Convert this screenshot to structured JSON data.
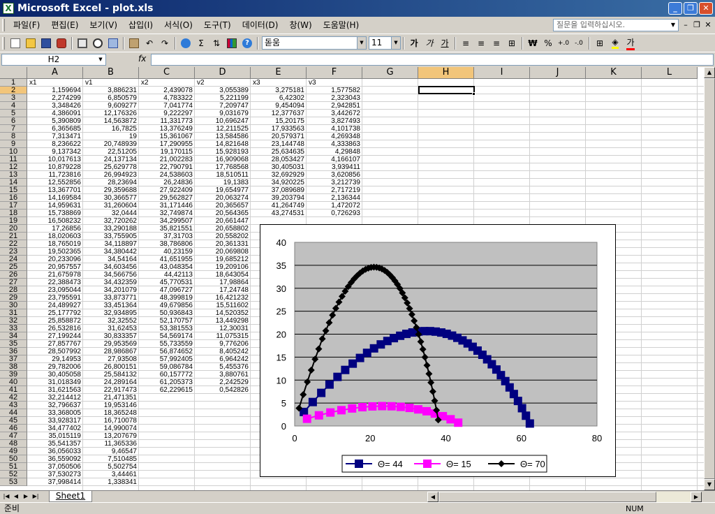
{
  "window": {
    "title": "Microsoft Excel - plot.xls",
    "app_icon": "X"
  },
  "menu": {
    "items": [
      "파일(F)",
      "편집(E)",
      "보기(V)",
      "삽입(I)",
      "서식(O)",
      "도구(T)",
      "데이터(D)",
      "창(W)",
      "도움말(H)"
    ],
    "help_placeholder": "질문을 입력하십시오."
  },
  "toolbar": {
    "font": "돋움",
    "size": "11",
    "bold": "가",
    "italic": "가",
    "underline": "가",
    "currency": "₩",
    "percent": "%",
    "autosum": "Σ",
    "font_color": "가"
  },
  "formula": {
    "name_box": "H2",
    "fx": "fx",
    "content": ""
  },
  "columns": [
    "A",
    "B",
    "C",
    "D",
    "E",
    "F",
    "G",
    "H",
    "I",
    "J",
    "K",
    "L"
  ],
  "selected_column": "H",
  "header_row": [
    "x1",
    "v1",
    "x2",
    "v2",
    "x3",
    "v3"
  ],
  "sheet": {
    "A": [
      "1,159694",
      "2,274299",
      "3,348426",
      "4,386091",
      "5,390809",
      "6,365685",
      "7,313471",
      "8,236622",
      "9,137342",
      "10,017613",
      "10,879228",
      "11,723816",
      "12,552856",
      "13,367701",
      "14,169584",
      "14,959631",
      "15,738869",
      "16,508232",
      "17,26856",
      "18,020603",
      "18,765019",
      "19,502365",
      "20,233096",
      "20,957557",
      "21,675978",
      "22,388473",
      "23,095044",
      "23,795591",
      "24,489927",
      "25,177792",
      "25,858872",
      "26,532816",
      "27,199244",
      "27,857767",
      "28,507992",
      "29,14953",
      "29,782006",
      "30,405058",
      "31,018349",
      "31,621563",
      "32,214412",
      "32,796637",
      "33,368005",
      "33,928317",
      "34,477402",
      "35,015119",
      "35,541357",
      "36,056033",
      "36,559092",
      "37,050506",
      "37,530273",
      "37,998414"
    ],
    "B": [
      "3,886231",
      "6,850579",
      "9,609277",
      "12,176326",
      "14,563872",
      "16,7825",
      "19",
      "20,748939",
      "22,51205",
      "24,137134",
      "25,629778",
      "26,994923",
      "28,23694",
      "29,359688",
      "30,366577",
      "31,260604",
      "32,0444",
      "32,720262",
      "33,290188",
      "33,755905",
      "34,118897",
      "34,380442",
      "34,54164",
      "34,603456",
      "34,566756",
      "34,432359",
      "34,201079",
      "33,873771",
      "33,451364",
      "32,934895",
      "32,32552",
      "31,62453",
      "30,833357",
      "29,953569",
      "28,986867",
      "27,93508",
      "26,800151",
      "25,584132",
      "24,289164",
      "22,917473",
      "21,471351",
      "19,953146",
      "18,365248",
      "16,710078",
      "14,990074",
      "13,207679",
      "11,365336",
      "9,46547",
      "7,510485",
      "5,502754",
      "3,44461",
      "1,338341"
    ],
    "C": [
      "2,439078",
      "4,783322",
      "7,041774",
      "9,222297",
      "11,331773",
      "13,376249",
      "15,361067",
      "17,290955",
      "19,170115",
      "21,002283",
      "22,790791",
      "24,538603",
      "26,24836",
      "27,922409",
      "29,562827",
      "31,171446",
      "32,749874",
      "34,299507",
      "35,821551",
      "37,31703",
      "38,786806",
      "40,23159",
      "41,651955",
      "43,048354",
      "44,42113",
      "45,770531",
      "47,096727",
      "48,399819",
      "49,679856",
      "50,936843",
      "52,170757",
      "53,381553",
      "54,569174",
      "55,733559",
      "56,874652",
      "57,992405",
      "59,086784",
      "60,157772",
      "61,205373",
      "62,229615"
    ],
    "D": [
      "3,055389",
      "5,221199",
      "7,209747",
      "9,031679",
      "10,696247",
      "12,211525",
      "13,584586",
      "14,821648",
      "15,928193",
      "16,909068",
      "17,768568",
      "18,510511",
      "19,1383",
      "19,654977",
      "20,063274",
      "20,365657",
      "20,564365",
      "20,661447",
      "20,658802",
      "20,558202",
      "20,361331",
      "20,069808",
      "19,685212",
      "19,209106",
      "18,643054",
      "17,98864",
      "17,24748",
      "16,421232",
      "15,511602",
      "14,520352",
      "13,449298",
      "12,30031",
      "11,075315",
      "9,776206",
      "8,405242",
      "6,964242",
      "5,455376",
      "3,880761",
      "2,242529",
      "0,542826"
    ],
    "E": [
      "3,275181",
      "6,42302",
      "9,454094",
      "12,377637",
      "15,20175",
      "17,933563",
      "20,579371",
      "23,144748",
      "25,634635",
      "28,053427",
      "30,405031",
      "32,692929",
      "34,920225",
      "37,089689",
      "39,203794",
      "41,264749",
      "43,274531"
    ],
    "F": [
      "1,577582",
      "2,323043",
      "2,942851",
      "3,442672",
      "3,827493",
      "4,101738",
      "4,269348",
      "4,333863",
      "4,29848",
      "4,166107",
      "3,939411",
      "3,620856",
      "3,212739",
      "2,717219",
      "2,136344",
      "1,472072",
      "0,726293"
    ]
  },
  "row_numbers": [
    "1",
    "2",
    "3",
    "4",
    "5",
    "6",
    "7",
    "8",
    "9",
    "10",
    "11",
    "12",
    "13",
    "14",
    "15",
    "16",
    "17",
    "18",
    "19",
    "20",
    "21",
    "22",
    "23",
    "24",
    "25",
    "26",
    "27",
    "28",
    "29",
    "30",
    "31",
    "32",
    "33",
    "34",
    "35",
    "36",
    "37",
    "38",
    "39",
    "40",
    "41",
    "42",
    "43",
    "44",
    "45",
    "46",
    "47",
    "48",
    "49",
    "50",
    "51",
    "52",
    "53"
  ],
  "tabs": {
    "sheet1": "Sheet1"
  },
  "status": {
    "ready": "준비",
    "num": "NUM"
  },
  "chart_data": {
    "type": "scatter",
    "xlim": [
      0,
      80
    ],
    "ylim": [
      0,
      40
    ],
    "xticks": [
      "0",
      "20",
      "40",
      "60",
      "80"
    ],
    "yticks": [
      "0",
      "5",
      "10",
      "15",
      "20",
      "25",
      "30",
      "35",
      "40"
    ],
    "grid": "horizontal",
    "plot_bg": "#c0c0c0",
    "legend_position": "bottom",
    "series": [
      {
        "name": "Θ= 44",
        "color": "#000080",
        "marker": "square",
        "x_col": "C",
        "y_col": "D"
      },
      {
        "name": "Θ= 15",
        "color": "#ff00ff",
        "marker": "square",
        "x_col": "E",
        "y_col": "F"
      },
      {
        "name": "Θ= 70",
        "color": "#000000",
        "marker": "diamond",
        "x_col": "A",
        "y_col": "B"
      }
    ]
  }
}
